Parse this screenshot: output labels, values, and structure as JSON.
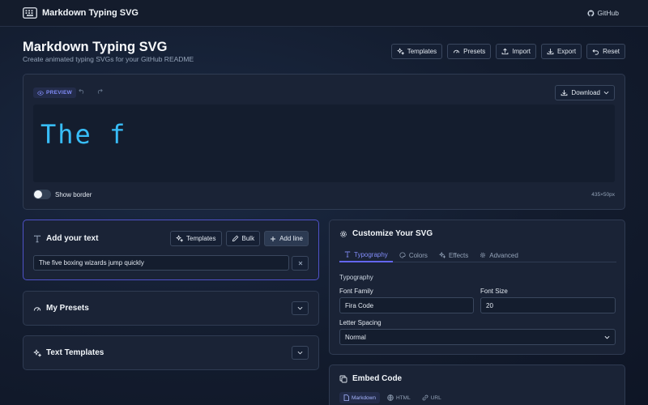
{
  "app": {
    "name": "Markdown Typing SVG",
    "github_label": "GitHub"
  },
  "header": {
    "title": "Markdown Typing SVG",
    "subtitle": "Create animated typing SVGs for your GitHub README",
    "actions": {
      "templates": "Templates",
      "presets": "Presets",
      "import": "Import",
      "export": "Export",
      "reset": "Reset"
    }
  },
  "preview": {
    "badge": "PREVIEW",
    "download": "Download",
    "typed_text": "The f",
    "show_border": "Show border",
    "dimensions": "435×50px"
  },
  "add_text": {
    "title": "Add your text",
    "templates": "Templates",
    "bulk": "Bulk",
    "add_line": "Add line",
    "line_value": "The five boxing wizards jump quickly"
  },
  "presets": {
    "title": "My Presets"
  },
  "templates": {
    "title": "Text Templates"
  },
  "customize": {
    "title": "Customize Your SVG",
    "tabs": {
      "typography": "Typography",
      "colors": "Colors",
      "effects": "Effects",
      "advanced": "Advanced"
    },
    "section": "Typography",
    "font_family_label": "Font Family",
    "font_family_value": "Fira Code",
    "font_size_label": "Font Size",
    "font_size_value": "20",
    "letter_spacing_label": "Letter Spacing",
    "letter_spacing_value": "Normal"
  },
  "embed": {
    "title": "Embed Code",
    "tabs": {
      "markdown": "Markdown",
      "html": "HTML",
      "url": "URL"
    }
  },
  "colors": {
    "accent": "#6366f1",
    "typed_text": "#38bdf8",
    "background": "#131c2e"
  }
}
